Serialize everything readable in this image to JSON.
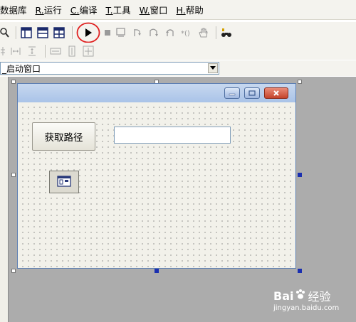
{
  "menubar": {
    "items": [
      {
        "key": "",
        "label": "数据库"
      },
      {
        "key": "R.",
        "label": "运行"
      },
      {
        "key": "C.",
        "label": "编译"
      },
      {
        "key": "T.",
        "label": "工具"
      },
      {
        "key": "W.",
        "label": "窗口"
      },
      {
        "key": "H.",
        "label": "帮助"
      }
    ]
  },
  "toolbar": {
    "icons": [
      "find-icon",
      "form-layout-icon",
      "grid-icon",
      "table-icon",
      "run-icon",
      "stop-icon",
      "step-icon",
      "step-into-icon",
      "step-over-icon",
      "step-out-icon",
      "run-to-cursor-icon",
      "hand-icon",
      "binoculars-icon"
    ],
    "align_icons": [
      "align-vcenter-icon",
      "space-horizontal-icon",
      "space-vertical-icon",
      "same-width-icon",
      "same-height-icon",
      "same-size-icon"
    ]
  },
  "component_selector": {
    "value": "_启动窗口"
  },
  "form": {
    "get_path_button": "获取路径",
    "path_textbox_value": ""
  },
  "watermark": {
    "logo_left": "Bai",
    "logo_right": "经验",
    "url": "jingyan.baidu.com"
  },
  "colors": {
    "highlight_circle": "#e02020",
    "form_title_bar": "#b5cbec",
    "workspace": "#acacac"
  }
}
